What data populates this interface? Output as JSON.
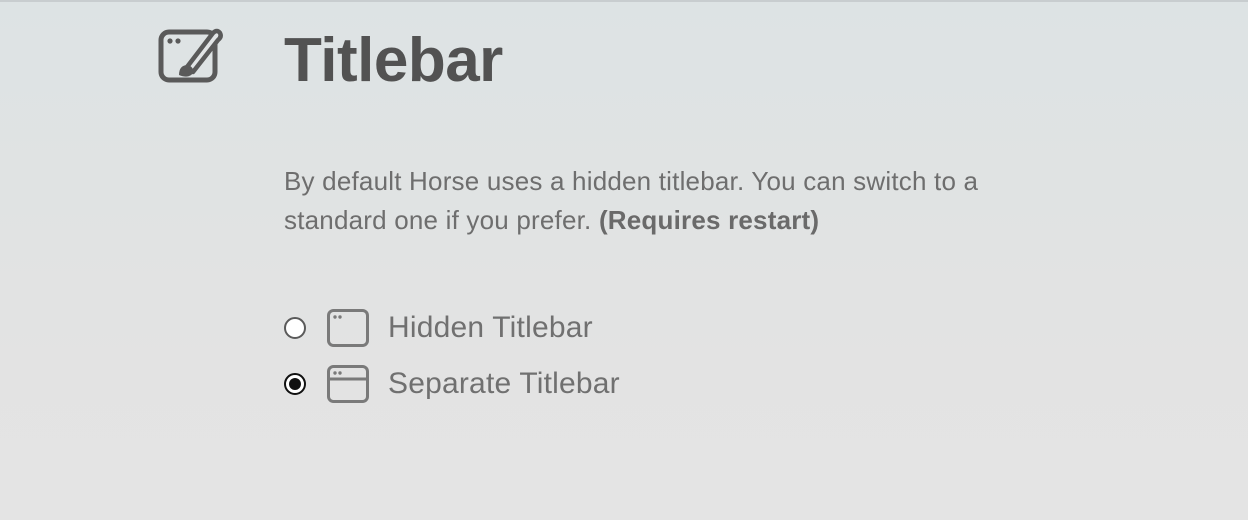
{
  "section": {
    "icon": "window-brush-icon",
    "title": "Titlebar",
    "description": "By default Horse uses a hidden titlebar. You can switch to a standard one if you prefer.",
    "description_note": "(Requires restart)"
  },
  "options": [
    {
      "label": "Hidden Titlebar",
      "icon": "window-hidden-titlebar-icon",
      "selected": false
    },
    {
      "label": "Separate Titlebar",
      "icon": "window-separate-titlebar-icon",
      "selected": true
    }
  ],
  "colors": {
    "title": "#525252",
    "text": "#6e6e6e",
    "icon": "#5a5a5a",
    "radio_selected": "#111111"
  }
}
